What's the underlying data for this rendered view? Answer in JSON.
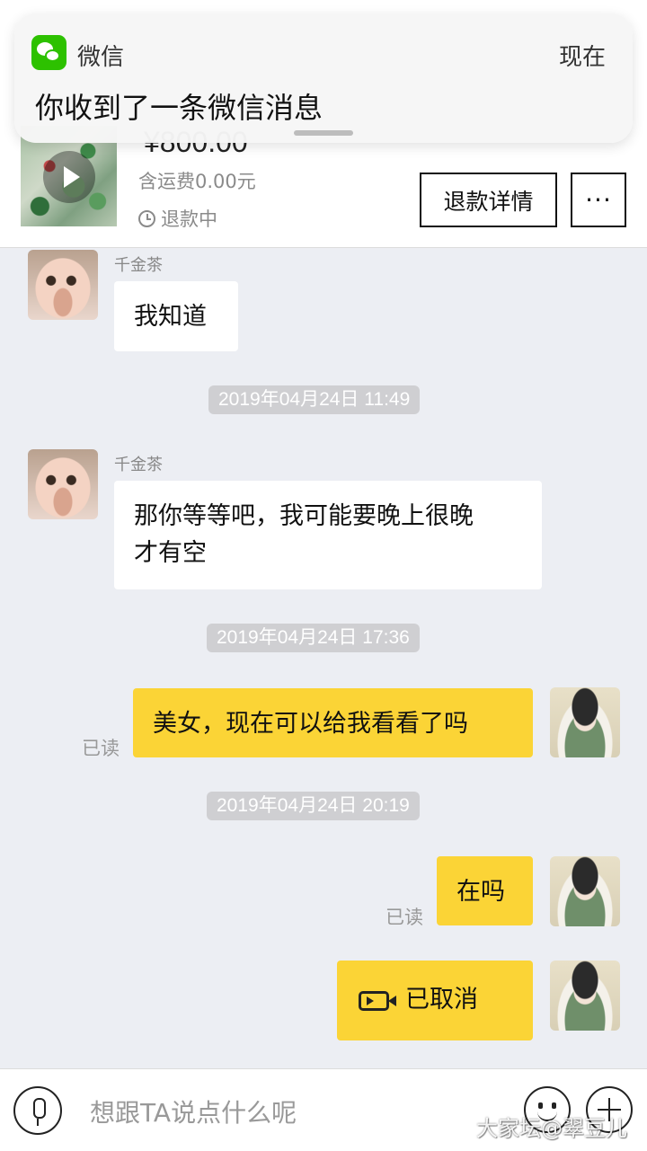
{
  "notification": {
    "app_name": "微信",
    "time": "现在",
    "message": "你收到了一条微信消息"
  },
  "product": {
    "price": "¥800.00",
    "shipping": "含运费0.00元",
    "status": "退款中",
    "refund_button": "退款详情",
    "more_button": "···"
  },
  "chat": {
    "messages": [
      {
        "sender": "千金茶",
        "text": "我知道"
      },
      {
        "timestamp": "2019年04月24日 11:49"
      },
      {
        "sender": "千金茶",
        "text_line1": "那你等等吧，我可能要晚上很晚",
        "text_line2": "才有空"
      },
      {
        "timestamp": "2019年04月24日 17:36"
      },
      {
        "text": "美女，现在可以给我看看了吗",
        "read": "已读"
      },
      {
        "timestamp": "2019年04月24日 20:19"
      },
      {
        "text": "在吗",
        "read": "已读"
      },
      {
        "text": "已取消"
      }
    ]
  },
  "input": {
    "placeholder": "想跟TA说点什么呢"
  },
  "watermark": "大家坛@翠豆儿",
  "colors": {
    "outgoing_bubble": "#fbd436",
    "incoming_bubble": "#ffffff",
    "wechat_green": "#2dc100",
    "background": "#eceef3"
  }
}
